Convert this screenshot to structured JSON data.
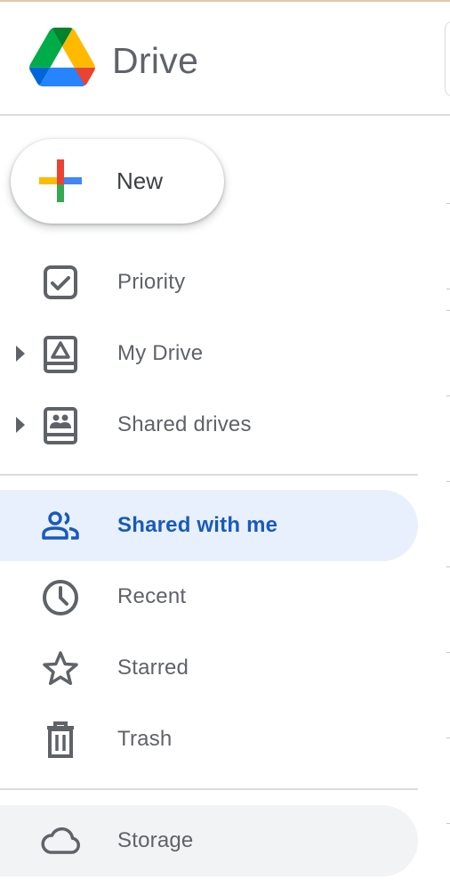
{
  "app": {
    "name": "Drive",
    "logo_icon": "google-drive-logo"
  },
  "new_button": {
    "label": "New",
    "icon": "plus-multicolor-icon"
  },
  "nav_primary": [
    {
      "label": "Priority",
      "icon": "checkbox-icon",
      "expandable": false
    },
    {
      "label": "My Drive",
      "icon": "my-drive-icon",
      "expandable": true
    },
    {
      "label": "Shared drives",
      "icon": "shared-drives-icon",
      "expandable": true
    }
  ],
  "nav_secondary": [
    {
      "label": "Shared with me",
      "icon": "people-icon",
      "selected": true
    },
    {
      "label": "Recent",
      "icon": "clock-icon",
      "selected": false
    },
    {
      "label": "Starred",
      "icon": "star-icon",
      "selected": false
    },
    {
      "label": "Trash",
      "icon": "trash-icon",
      "selected": false
    }
  ],
  "storage": {
    "label": "Storage",
    "icon": "cloud-icon"
  },
  "colors": {
    "active_bg": "#e8f0fe",
    "active_text": "#185abc",
    "text": "#5f6368",
    "divider": "#dadce0",
    "storage_bg": "#f1f3f4",
    "google_blue": "#4285f4",
    "google_red": "#ea4335",
    "google_yellow": "#fbbc04",
    "google_green": "#34a853"
  }
}
